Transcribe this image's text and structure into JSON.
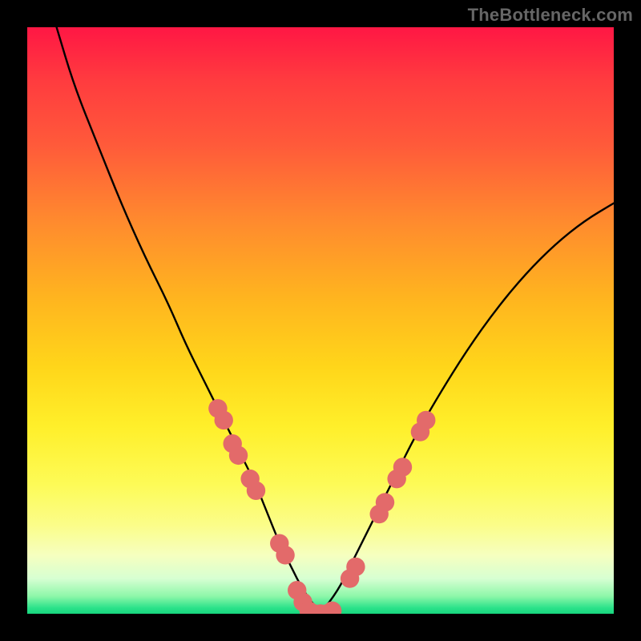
{
  "watermark": "TheBottleneck.com",
  "chart_data": {
    "type": "line",
    "title": "",
    "xlabel": "",
    "ylabel": "",
    "xlim": [
      0,
      100
    ],
    "ylim": [
      0,
      100
    ],
    "gradient_stops": [
      {
        "pct": 0,
        "color": "#ff1744"
      },
      {
        "pct": 9,
        "color": "#ff3b3f"
      },
      {
        "pct": 20,
        "color": "#ff5a3a"
      },
      {
        "pct": 33,
        "color": "#ff8a2e"
      },
      {
        "pct": 46,
        "color": "#ffb41f"
      },
      {
        "pct": 58,
        "color": "#ffd61a"
      },
      {
        "pct": 68,
        "color": "#ffef2a"
      },
      {
        "pct": 78,
        "color": "#fdfb57"
      },
      {
        "pct": 85,
        "color": "#fbfd8a"
      },
      {
        "pct": 90,
        "color": "#f6ffbf"
      },
      {
        "pct": 94,
        "color": "#d7ffd2"
      },
      {
        "pct": 97,
        "color": "#8ef7a9"
      },
      {
        "pct": 99,
        "color": "#2be28a"
      },
      {
        "pct": 100,
        "color": "#17d67e"
      }
    ],
    "series": [
      {
        "name": "v-curve",
        "color": "#000000",
        "x": [
          5,
          8,
          12,
          16,
          20,
          24,
          27,
          30,
          33,
          36,
          39,
          41,
          43,
          45,
          47,
          50,
          53,
          55,
          57,
          60,
          63,
          66,
          70,
          75,
          80,
          85,
          90,
          95,
          100
        ],
        "y": [
          100,
          90,
          80,
          70,
          61,
          53,
          46,
          40,
          34,
          28,
          22,
          17,
          12,
          8,
          4,
          0,
          4,
          8,
          12,
          18,
          24,
          30,
          37,
          45,
          52,
          58,
          63,
          67,
          70
        ]
      }
    ],
    "markers": {
      "color": "#e36a6a",
      "radius": 1.6,
      "points": [
        {
          "x": 32.5,
          "y": 35
        },
        {
          "x": 33.5,
          "y": 33
        },
        {
          "x": 35,
          "y": 29
        },
        {
          "x": 36,
          "y": 27
        },
        {
          "x": 38,
          "y": 23
        },
        {
          "x": 39,
          "y": 21
        },
        {
          "x": 43,
          "y": 12
        },
        {
          "x": 44,
          "y": 10
        },
        {
          "x": 46,
          "y": 4
        },
        {
          "x": 47,
          "y": 2
        },
        {
          "x": 48,
          "y": 0.5
        },
        {
          "x": 49,
          "y": 0
        },
        {
          "x": 50,
          "y": 0
        },
        {
          "x": 51,
          "y": 0
        },
        {
          "x": 52,
          "y": 0.5
        },
        {
          "x": 55,
          "y": 6
        },
        {
          "x": 56,
          "y": 8
        },
        {
          "x": 60,
          "y": 17
        },
        {
          "x": 61,
          "y": 19
        },
        {
          "x": 63,
          "y": 23
        },
        {
          "x": 64,
          "y": 25
        },
        {
          "x": 67,
          "y": 31
        },
        {
          "x": 68,
          "y": 33
        }
      ]
    }
  }
}
